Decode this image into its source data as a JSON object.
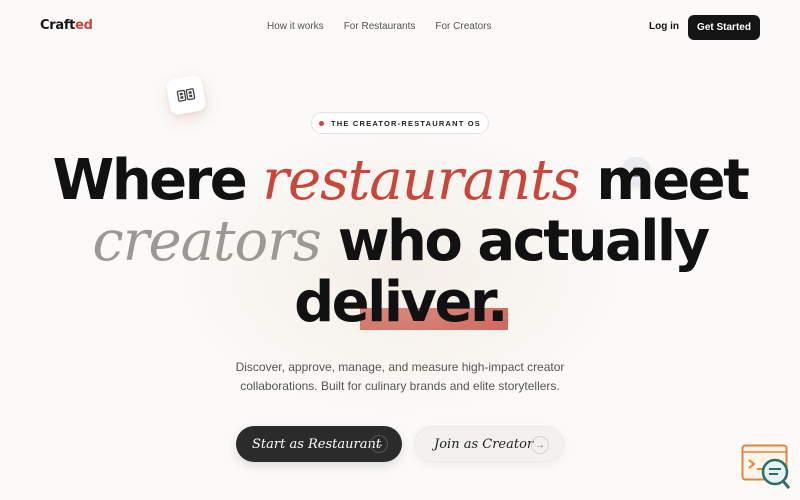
{
  "nav": {
    "logo_main": "Craft",
    "logo_accent": "ed",
    "links": [
      "How it works",
      "For Restaurants",
      "For Creators"
    ],
    "login": "Log in",
    "cta": "Get Started"
  },
  "hero": {
    "badge": "THE CREATOR-RESTAURANT OS",
    "line1_a": "Where",
    "line1_b": "restaurants",
    "line1_c": "meet",
    "line2_a": "creators",
    "line2_b": "who actually",
    "line3_a": "del",
    "line3_b": "iver.",
    "sub1": "Discover, approve, manage, and measure high-impact creator",
    "sub2": "collaborations. Built for culinary brands and elite storytellers.",
    "primary_cta": "Start as Restaurant",
    "secondary_cta": "Join as Creator"
  },
  "icons": {
    "arrow": "→",
    "float_card": "grid-icon",
    "float_circle": "phone-icon",
    "chat": "chat-support-icon"
  },
  "colors": {
    "accent": "#c8463b",
    "dark": "#151515",
    "muted": "#9c9994",
    "background": "#fbfaf8"
  }
}
